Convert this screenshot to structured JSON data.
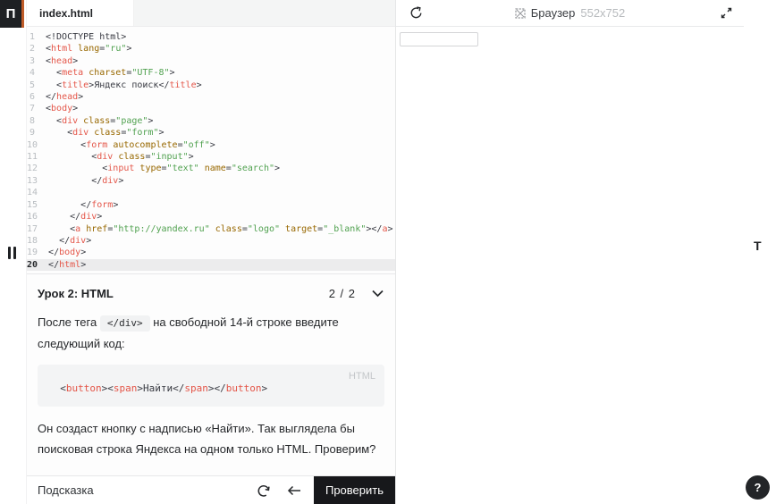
{
  "rail": {
    "logo_letter": "П"
  },
  "tabbar": {
    "tabs": [
      {
        "label": "index.html",
        "active": true
      }
    ]
  },
  "editor": {
    "active_line": 20,
    "lines": [
      "<!DOCTYPE html>",
      "<html lang=\"ru\">",
      "<head>",
      "  <meta charset=\"UTF-8\">",
      "  <title>Яндекс поиск</title>",
      "</head>",
      "<body>",
      "  <div class=\"page\">",
      "    <div class=\"form\">",
      "      <form autocomplete=\"off\">",
      "        <div class=\"input\">",
      "          <input type=\"text\" name=\"search\">",
      "        </div>",
      "",
      "      </form>",
      "    </div>",
      "    <a href=\"http://yandex.ru\" class=\"logo\" target=\"_blank\"></a>",
      "  </div>",
      "</body>",
      "</html>"
    ]
  },
  "lesson": {
    "title": "Урок 2: HTML",
    "pager": "2 / 2",
    "p1_before": "После тега",
    "p1_code": "</div>",
    "p1_after": "на свободной 14-й строке введите следующий код:",
    "code_block": {
      "lang_label": "HTML",
      "code": "  <button><span>Найти</span></button>"
    },
    "p2": "Он создаст кнопку с надписью «Найти». Так выглядела бы поисковая строка Яндекса на одном только HTML. Проверим?"
  },
  "actionbar": {
    "hint_label": "Подсказка",
    "check_label": "Проверить"
  },
  "browser": {
    "title": "Браузер",
    "viewport_size": "552x752"
  },
  "right_rail": {
    "theory_toggle": "T",
    "help_label": "?"
  }
}
